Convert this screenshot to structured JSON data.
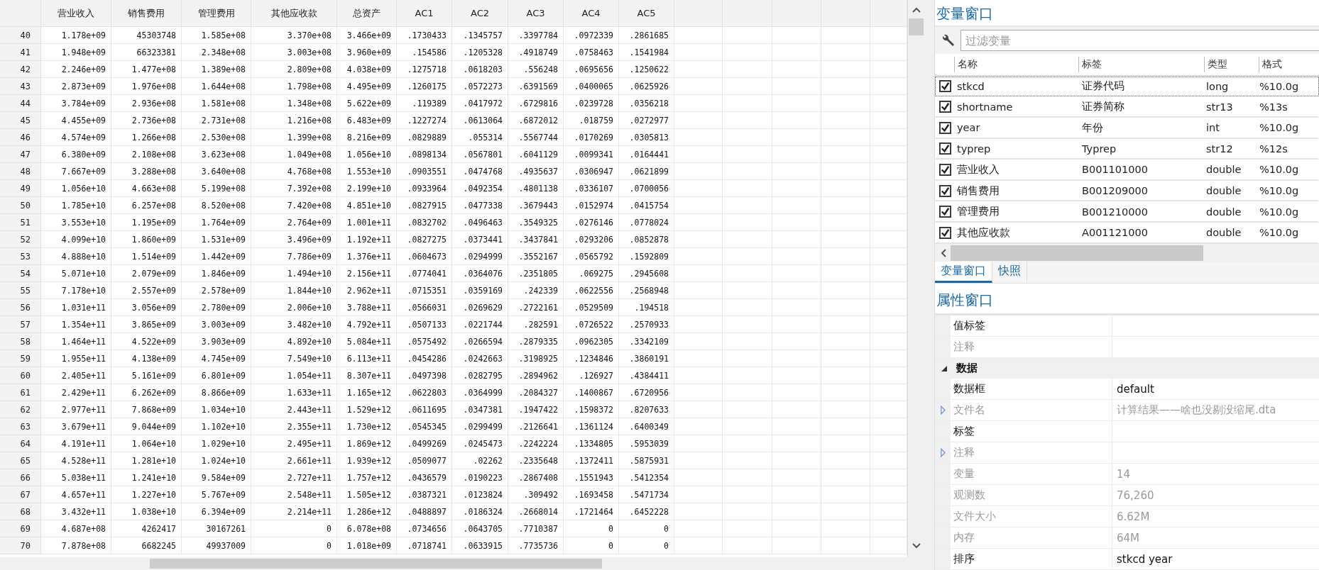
{
  "data_editor": {
    "columns": [
      "营业收入",
      "销售费用",
      "管理费用",
      "其他应收款",
      "总资产",
      "AC1",
      "AC2",
      "AC3",
      "AC4",
      "AC5"
    ],
    "rows": [
      {
        "row": "40",
        "cells": [
          "1.178e+09",
          "45303748",
          "1.585e+08",
          "3.370e+08",
          "3.466e+09",
          ".1730433",
          ".1345757",
          ".3397784",
          ".0972339",
          ".2861685"
        ]
      },
      {
        "row": "41",
        "cells": [
          "1.948e+09",
          "66323381",
          "2.348e+08",
          "3.003e+08",
          "3.960e+09",
          ".154586",
          ".1205328",
          ".4918749",
          ".0758463",
          ".1541984"
        ]
      },
      {
        "row": "42",
        "cells": [
          "2.246e+09",
          "1.477e+08",
          "1.389e+08",
          "2.809e+08",
          "4.038e+09",
          ".1275718",
          ".0618203",
          ".556248",
          ".0695656",
          ".1250622"
        ]
      },
      {
        "row": "43",
        "cells": [
          "2.873e+09",
          "1.976e+08",
          "1.644e+08",
          "1.798e+08",
          "4.495e+09",
          ".1260175",
          ".0572273",
          ".6391569",
          ".0400065",
          ".0625926"
        ]
      },
      {
        "row": "44",
        "cells": [
          "3.784e+09",
          "2.936e+08",
          "1.581e+08",
          "1.348e+08",
          "5.622e+09",
          ".119389",
          ".0417972",
          ".6729816",
          ".0239728",
          ".0356218"
        ]
      },
      {
        "row": "45",
        "cells": [
          "4.455e+09",
          "2.736e+08",
          "2.731e+08",
          "1.216e+08",
          "6.483e+09",
          ".1227274",
          ".0613064",
          ".6872012",
          ".018759",
          ".0272977"
        ]
      },
      {
        "row": "46",
        "cells": [
          "4.574e+09",
          "1.266e+08",
          "2.530e+08",
          "1.399e+08",
          "8.216e+09",
          ".0829889",
          ".055314",
          ".5567744",
          ".0170269",
          ".0305813"
        ]
      },
      {
        "row": "47",
        "cells": [
          "6.380e+09",
          "2.108e+08",
          "3.623e+08",
          "1.049e+08",
          "1.056e+10",
          ".0898134",
          ".0567801",
          ".6041129",
          ".0099341",
          ".0164441"
        ]
      },
      {
        "row": "48",
        "cells": [
          "7.667e+09",
          "3.288e+08",
          "3.640e+08",
          "4.768e+08",
          "1.553e+10",
          ".0903551",
          ".0474768",
          ".4935637",
          ".0306947",
          ".0621899"
        ]
      },
      {
        "row": "49",
        "cells": [
          "1.056e+10",
          "4.663e+08",
          "5.199e+08",
          "7.392e+08",
          "2.199e+10",
          ".0933964",
          ".0492354",
          ".4801138",
          ".0336107",
          ".0700056"
        ]
      },
      {
        "row": "50",
        "cells": [
          "1.785e+10",
          "6.257e+08",
          "8.520e+08",
          "7.420e+08",
          "4.851e+10",
          ".0827915",
          ".0477338",
          ".3679443",
          ".0152974",
          ".0415754"
        ]
      },
      {
        "row": "51",
        "cells": [
          "3.553e+10",
          "1.195e+09",
          "1.764e+09",
          "2.764e+09",
          "1.001e+11",
          ".0832702",
          ".0496463",
          ".3549325",
          ".0276146",
          ".0778024"
        ]
      },
      {
        "row": "52",
        "cells": [
          "4.099e+10",
          "1.860e+09",
          "1.531e+09",
          "3.496e+09",
          "1.192e+11",
          ".0827275",
          ".0373441",
          ".3437841",
          ".0293206",
          ".0852878"
        ]
      },
      {
        "row": "53",
        "cells": [
          "4.888e+10",
          "1.514e+09",
          "1.442e+09",
          "7.786e+09",
          "1.376e+11",
          ".0604673",
          ".0294999",
          ".3552167",
          ".0565792",
          ".1592809"
        ]
      },
      {
        "row": "54",
        "cells": [
          "5.071e+10",
          "2.079e+09",
          "1.846e+09",
          "1.494e+10",
          "2.156e+11",
          ".0774041",
          ".0364076",
          ".2351805",
          ".069275",
          ".2945608"
        ]
      },
      {
        "row": "55",
        "cells": [
          "7.178e+10",
          "2.557e+09",
          "2.578e+09",
          "1.844e+10",
          "2.962e+11",
          ".0715351",
          ".0359169",
          ".242339",
          ".0622556",
          ".2568948"
        ]
      },
      {
        "row": "56",
        "cells": [
          "1.031e+11",
          "3.056e+09",
          "2.780e+09",
          "2.006e+10",
          "3.788e+11",
          ".0566031",
          ".0269629",
          ".2722161",
          ".0529509",
          ".194518"
        ]
      },
      {
        "row": "57",
        "cells": [
          "1.354e+11",
          "3.865e+09",
          "3.003e+09",
          "3.482e+10",
          "4.792e+11",
          ".0507133",
          ".0221744",
          ".282591",
          ".0726522",
          ".2570933"
        ]
      },
      {
        "row": "58",
        "cells": [
          "1.464e+11",
          "4.522e+09",
          "3.903e+09",
          "4.892e+10",
          "5.084e+11",
          ".0575492",
          ".0266594",
          ".2879335",
          ".0962305",
          ".3342109"
        ]
      },
      {
        "row": "59",
        "cells": [
          "1.955e+11",
          "4.138e+09",
          "4.745e+09",
          "7.549e+10",
          "6.113e+11",
          ".0454286",
          ".0242663",
          ".3198925",
          ".1234846",
          ".3860191"
        ]
      },
      {
        "row": "60",
        "cells": [
          "2.405e+11",
          "5.161e+09",
          "6.801e+09",
          "1.054e+11",
          "8.307e+11",
          ".0497398",
          ".0282795",
          ".2894962",
          ".126927",
          ".4384411"
        ]
      },
      {
        "row": "61",
        "cells": [
          "2.429e+11",
          "6.262e+09",
          "8.866e+09",
          "1.633e+11",
          "1.165e+12",
          ".0622803",
          ".0364999",
          ".2084327",
          ".1400867",
          ".6720956"
        ]
      },
      {
        "row": "62",
        "cells": [
          "2.977e+11",
          "7.868e+09",
          "1.034e+10",
          "2.443e+11",
          "1.529e+12",
          ".0611695",
          ".0347381",
          ".1947422",
          ".1598372",
          ".8207633"
        ]
      },
      {
        "row": "63",
        "cells": [
          "3.679e+11",
          "9.044e+09",
          "1.102e+10",
          "2.355e+11",
          "1.730e+12",
          ".0545345",
          ".0299499",
          ".2126641",
          ".1361124",
          ".6400349"
        ]
      },
      {
        "row": "64",
        "cells": [
          "4.191e+11",
          "1.064e+10",
          "1.029e+10",
          "2.495e+11",
          "1.869e+12",
          ".0499269",
          ".0245473",
          ".2242224",
          ".1334805",
          ".5953039"
        ]
      },
      {
        "row": "65",
        "cells": [
          "4.528e+11",
          "1.281e+10",
          "1.024e+10",
          "2.661e+11",
          "1.939e+12",
          ".0509077",
          ".02262",
          ".2335648",
          ".1372411",
          ".5875931"
        ]
      },
      {
        "row": "66",
        "cells": [
          "5.038e+11",
          "1.241e+10",
          "9.584e+09",
          "2.727e+11",
          "1.757e+12",
          ".0436579",
          ".0190223",
          ".2867408",
          ".1551943",
          ".5412354"
        ]
      },
      {
        "row": "67",
        "cells": [
          "4.657e+11",
          "1.227e+10",
          "5.767e+09",
          "2.548e+11",
          "1.505e+12",
          ".0387321",
          ".0123824",
          ".309492",
          ".1693458",
          ".5471734"
        ]
      },
      {
        "row": "68",
        "cells": [
          "3.432e+11",
          "1.038e+10",
          "6.394e+09",
          "2.214e+11",
          "1.286e+12",
          ".0488897",
          ".0186324",
          ".2668014",
          ".1721464",
          ".6452228"
        ]
      },
      {
        "row": "69",
        "cells": [
          "4.687e+08",
          "4262417",
          "30167261",
          "0",
          "6.078e+08",
          ".0734656",
          ".0643705",
          ".7710387",
          "0",
          "0"
        ]
      },
      {
        "row": "70",
        "cells": [
          "7.878e+08",
          "6682245",
          "49937009",
          "0",
          "1.018e+09",
          ".0718741",
          ".0633915",
          ".7735736",
          "0",
          "0"
        ]
      }
    ]
  },
  "variables_window": {
    "title": "变量窗口",
    "filter": {
      "placeholder": "过滤变量"
    },
    "columns": [
      "名称",
      "标签",
      "类型",
      "格式"
    ],
    "variables": [
      {
        "name": "stkcd",
        "label": "证券代码",
        "type": "long",
        "format": "%10.0g",
        "checked": true,
        "selected": true
      },
      {
        "name": "shortname",
        "label": "证券简称",
        "type": "str13",
        "format": "%13s",
        "checked": true,
        "selected": false
      },
      {
        "name": "year",
        "label": "年份",
        "type": "int",
        "format": "%10.0g",
        "checked": true,
        "selected": false
      },
      {
        "name": "typrep",
        "label": "Typrep",
        "type": "str12",
        "format": "%12s",
        "checked": true,
        "selected": false
      },
      {
        "name": "营业收入",
        "label": "B001101000",
        "type": "double",
        "format": "%10.0g",
        "checked": true,
        "selected": false
      },
      {
        "name": "销售费用",
        "label": "B001209000",
        "type": "double",
        "format": "%10.0g",
        "checked": true,
        "selected": false
      },
      {
        "name": "管理费用",
        "label": "B001210000",
        "type": "double",
        "format": "%10.0g",
        "checked": true,
        "selected": false
      },
      {
        "name": "其他应收款",
        "label": "A001121000",
        "type": "double",
        "format": "%10.0g",
        "checked": true,
        "selected": false
      }
    ],
    "tabs": [
      {
        "label": "变量窗口",
        "selected": true
      },
      {
        "label": "快照",
        "selected": false
      }
    ]
  },
  "properties_window": {
    "title": "属性窗口",
    "rows": [
      {
        "kind": "row",
        "name": "值标签",
        "disabled": false,
        "expandable": false
      },
      {
        "kind": "row",
        "name": "注释",
        "disabled": true,
        "expandable": false
      },
      {
        "kind": "section",
        "name": "数据",
        "expanded": true
      },
      {
        "kind": "row",
        "name": "数据框",
        "value": "default",
        "disabled": false,
        "expandable": false
      },
      {
        "kind": "row",
        "name": "文件名",
        "value": "计算结果——啥也没剔没缩尾.dta",
        "disabled": true,
        "expandable": true
      },
      {
        "kind": "row",
        "name": "标签",
        "disabled": false,
        "expandable": false
      },
      {
        "kind": "row",
        "name": "注释",
        "disabled": true,
        "expandable": true
      },
      {
        "kind": "row",
        "name": "变量",
        "value": "14",
        "disabled": true,
        "expandable": false
      },
      {
        "kind": "row",
        "name": "观测数",
        "value": "76,260",
        "disabled": true,
        "expandable": false
      },
      {
        "kind": "row",
        "name": "文件大小",
        "value": "6.62M",
        "disabled": true,
        "expandable": false
      },
      {
        "kind": "row",
        "name": "内存",
        "value": "64M",
        "disabled": true,
        "expandable": false
      },
      {
        "kind": "row",
        "name": "排序",
        "value": "stkcd year",
        "disabled": false,
        "expandable": false
      }
    ]
  }
}
